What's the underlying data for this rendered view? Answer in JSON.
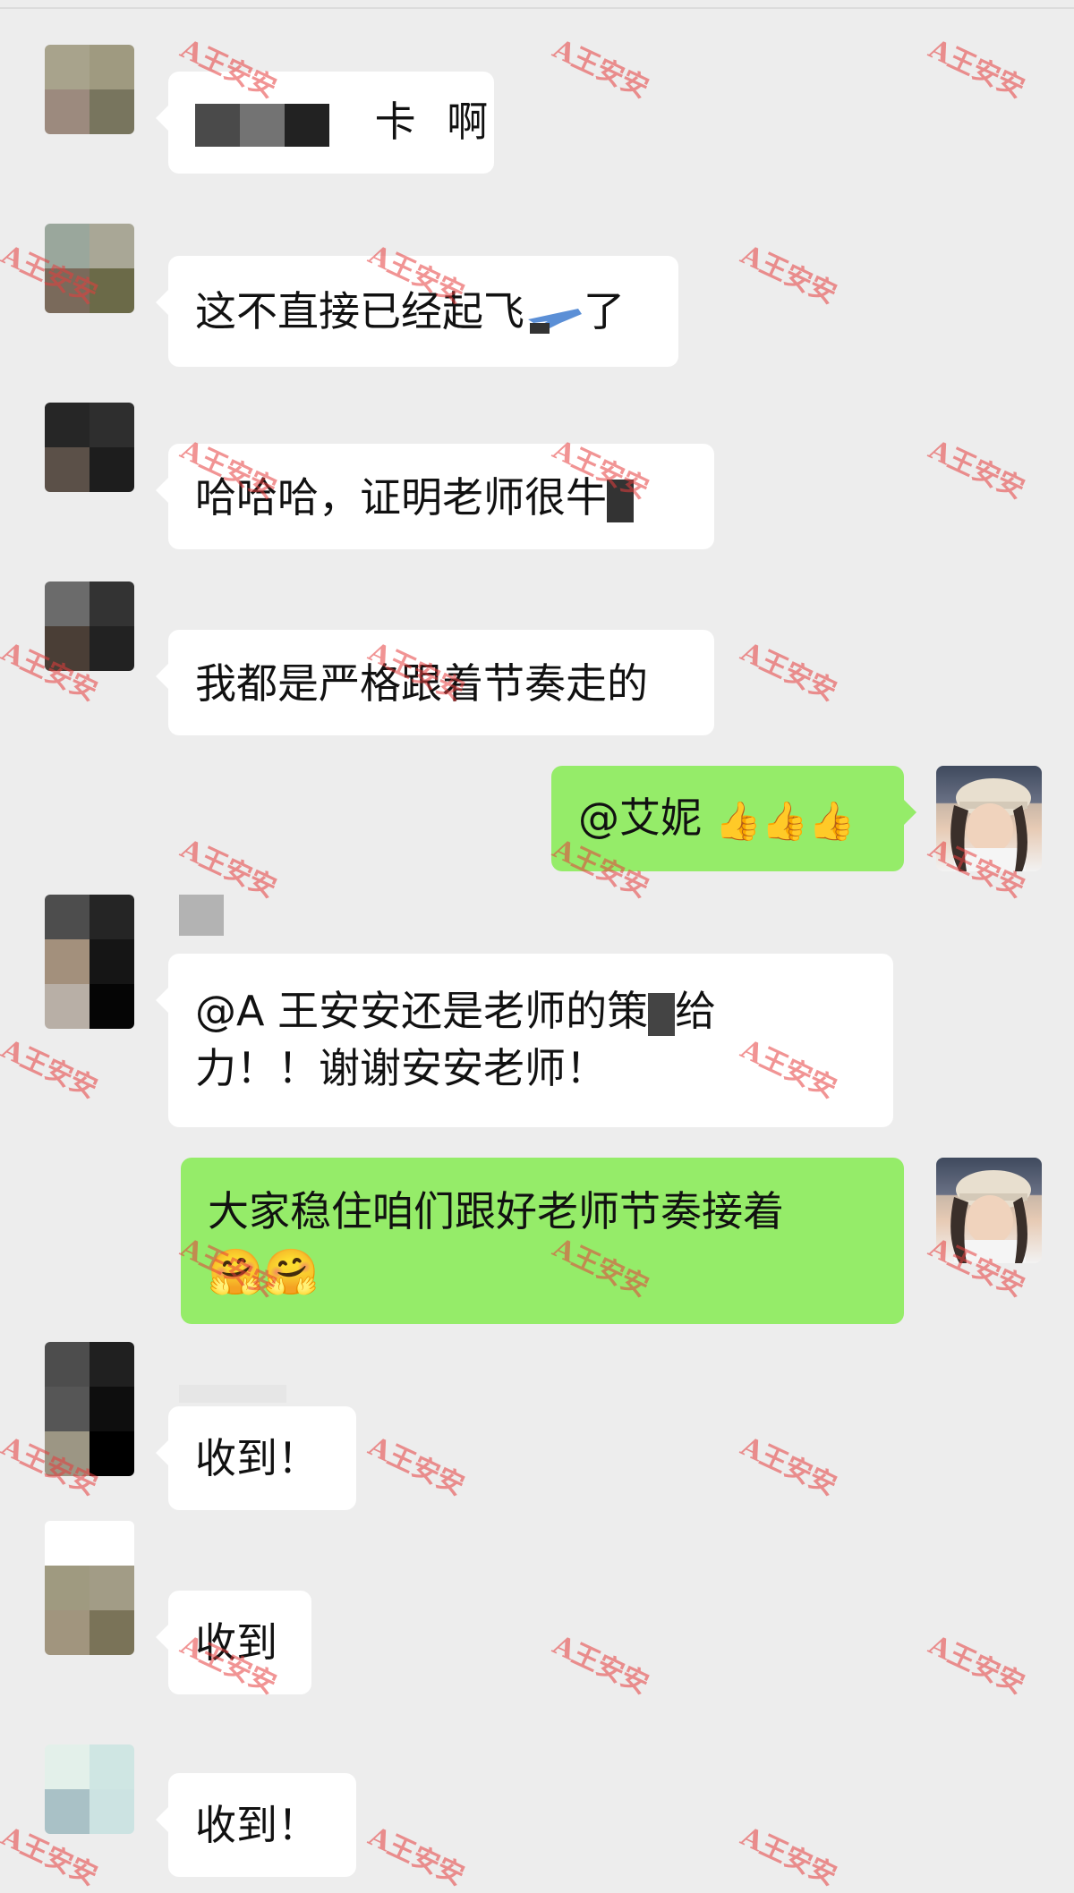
{
  "messages": [
    {
      "text_fragments": [
        "卡",
        "啊"
      ]
    },
    {
      "text_before": "这不直接已经起飞",
      "text_after": "了"
    },
    {
      "text": "哈哈哈，证明老师很牛"
    },
    {
      "text": "我都是严格跟着节奏走的"
    },
    {
      "text": "@艾妮",
      "emoji": "👍👍👍"
    },
    {
      "line1_before": "@A 王安安还是老师的策",
      "line1_after": "给",
      "line2": "力！！谢谢安安老师！"
    },
    {
      "text": "大家稳住咱们跟好老师节奏接着",
      "emoji": "🤗🤗"
    },
    {
      "text": "收到！"
    },
    {
      "text": "收到"
    },
    {
      "text": "收到！"
    }
  ],
  "watermark": "A王安安",
  "colors": {
    "background": "#ededed",
    "bubble_in": "#ffffff",
    "bubble_out": "#95ec69",
    "watermark": "#e63c3c"
  }
}
